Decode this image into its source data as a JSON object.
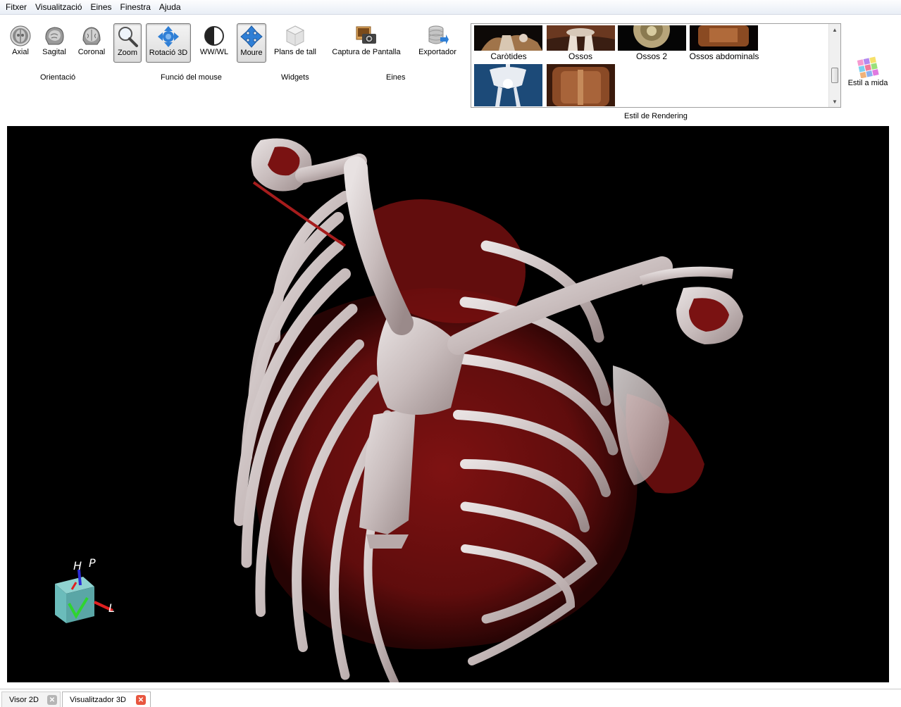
{
  "menu": [
    "Fitxer",
    "Visualització",
    "Eines",
    "Finestra",
    "Ajuda"
  ],
  "toolbar": {
    "orientation": {
      "label": "Orientació",
      "buttons": [
        {
          "label": "Axial",
          "icon": "axial-brain-icon"
        },
        {
          "label": "Sagital",
          "icon": "sagittal-brain-icon"
        },
        {
          "label": "Coronal",
          "icon": "coronal-brain-icon"
        }
      ]
    },
    "mouse": {
      "label": "Funció del mouse",
      "buttons": [
        {
          "label": "Zoom",
          "icon": "magnifier-icon",
          "pressed": true
        },
        {
          "label": "Rotació 3D",
          "icon": "rotate-3d-icon",
          "pressed": true
        },
        {
          "label": "WW/WL",
          "icon": "window-level-icon",
          "pressed": false
        },
        {
          "label": "Moure",
          "icon": "move-arrows-icon",
          "pressed": true
        }
      ]
    },
    "widgets": {
      "label": "Widgets",
      "buttons": [
        {
          "label": "Plans de tall",
          "icon": "clipping-planes-icon"
        }
      ]
    },
    "tools": {
      "label": "Eines",
      "buttons": [
        {
          "label": "Captura de Pantalla",
          "icon": "camera-icon"
        },
        {
          "label": "Exportador",
          "icon": "database-export-icon"
        }
      ]
    },
    "rendering": {
      "label": "Estil de Rendering",
      "presets": [
        "Caròtides",
        "Ossos",
        "Ossos 2",
        "Ossos abdominals"
      ]
    },
    "custom_style": {
      "label": "Estil a mida",
      "icon": "color-palette-icon"
    }
  },
  "viewer": {
    "orientation_marker": {
      "labels": [
        "H",
        "P",
        "L"
      ]
    }
  },
  "tabs": [
    {
      "label": "Visor 2D",
      "active": false
    },
    {
      "label": "Visualitzador 3D",
      "active": true
    }
  ],
  "colors": {
    "accent_blue": "#2f7fd6",
    "tab_close_active": "#e8563f",
    "tab_close_inactive": "#b5b5b5",
    "render_background": "#000000",
    "tissue_red": "#8c1414",
    "bone": "#cfc8c8"
  }
}
